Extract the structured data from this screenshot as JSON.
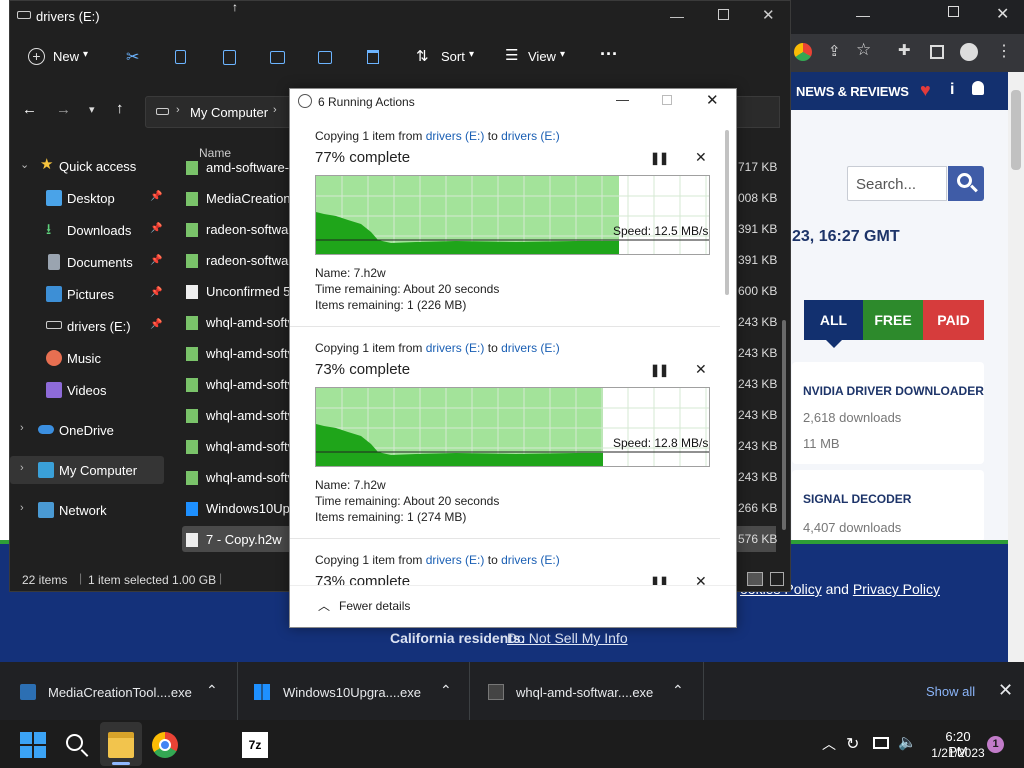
{
  "chrome": {
    "site_nav": "NEWS & REVIEWS",
    "search_placeholder": "Search...",
    "date_line": "23, 16:27 GMT",
    "filter_tabs": [
      "ALL",
      "FREE",
      "PAID"
    ],
    "cards": [
      {
        "title": "NVIDIA DRIVER DOWNLOADER",
        "downloads": "2,618 downloads",
        "size": "11 MB"
      },
      {
        "title": "SIGNAL DECODER",
        "downloads": "4,407 downloads"
      }
    ],
    "cookie_links": {
      "a": "ookies Policy",
      "and": "and",
      "b": "Privacy Policy"
    },
    "california": "California residents:",
    "do_not_sell": "Do Not Sell My Info"
  },
  "downloads_bar": {
    "items": [
      {
        "name": "MediaCreationTool....exe"
      },
      {
        "name": "Windows10Upgra....exe"
      },
      {
        "name": "whql-amd-softwar....exe"
      }
    ],
    "show_all": "Show all"
  },
  "taskbar": {
    "time": "6:20 PM",
    "date": "1/21/2023",
    "notifications": "1"
  },
  "explorer": {
    "title": "drivers (E:)",
    "toolbar": {
      "new": "New",
      "sort": "Sort",
      "view": "View"
    },
    "breadcrumb": "My Computer",
    "nav": {
      "quick_access": "Quick access",
      "desktop": "Desktop",
      "downloads": "Downloads",
      "documents": "Documents",
      "pictures": "Pictures",
      "drivers": "drivers (E:)",
      "music": "Music",
      "videos": "Videos",
      "onedrive": "OneDrive",
      "my_computer": "My Computer",
      "network": "Network"
    },
    "column_name": "Name",
    "files": [
      {
        "name": "amd-software-a",
        "size": "717 KB"
      },
      {
        "name": "MediaCreationT",
        "size": "008 KB"
      },
      {
        "name": "radeon-softwar",
        "size": "391 KB"
      },
      {
        "name": "radeon-softwar",
        "size": "391 KB"
      },
      {
        "name": "Unconfirmed 52",
        "size": "600 KB"
      },
      {
        "name": "whql-amd-softv",
        "size": "243 KB"
      },
      {
        "name": "whql-amd-softv",
        "size": "243 KB"
      },
      {
        "name": "whql-amd-softv",
        "size": "243 KB"
      },
      {
        "name": "whql-amd-softv",
        "size": "243 KB"
      },
      {
        "name": "whql-amd-softv",
        "size": "243 KB"
      },
      {
        "name": "whql-amd-softv",
        "size": "243 KB"
      },
      {
        "name": "Windows10Upg",
        "size": "266 KB"
      },
      {
        "name": "7 - Copy.h2w",
        "size": "576 KB"
      }
    ],
    "status": {
      "count": "22 items",
      "selected": "1 item selected  1.00 GB"
    }
  },
  "dialog": {
    "title": "6 Running Actions",
    "operations": [
      {
        "copying": "Copying 1 item from",
        "src": "drivers (E:)",
        "to": "to",
        "dst": "drivers (E:)",
        "percent_text": "77% complete",
        "progress": 0.77,
        "speed": "Speed: 12.5 MB/s",
        "name": "Name:  7.h2w",
        "time": "Time remaining:  About 20 seconds",
        "items": "Items remaining:  1 (226 MB)"
      },
      {
        "copying": "Copying 1 item from",
        "src": "drivers (E:)",
        "to": "to",
        "dst": "drivers (E:)",
        "percent_text": "73% complete",
        "progress": 0.73,
        "speed": "Speed: 12.8 MB/s",
        "name": "Name:  7.h2w",
        "time": "Time remaining:  About 20 seconds",
        "items": "Items remaining:  1 (274 MB)"
      },
      {
        "copying": "Copying 1 item from",
        "src": "drivers (E:)",
        "to": "to",
        "dst": "drivers (E:)",
        "percent_text": "73% complete"
      }
    ],
    "fewer_details": "Fewer details"
  }
}
